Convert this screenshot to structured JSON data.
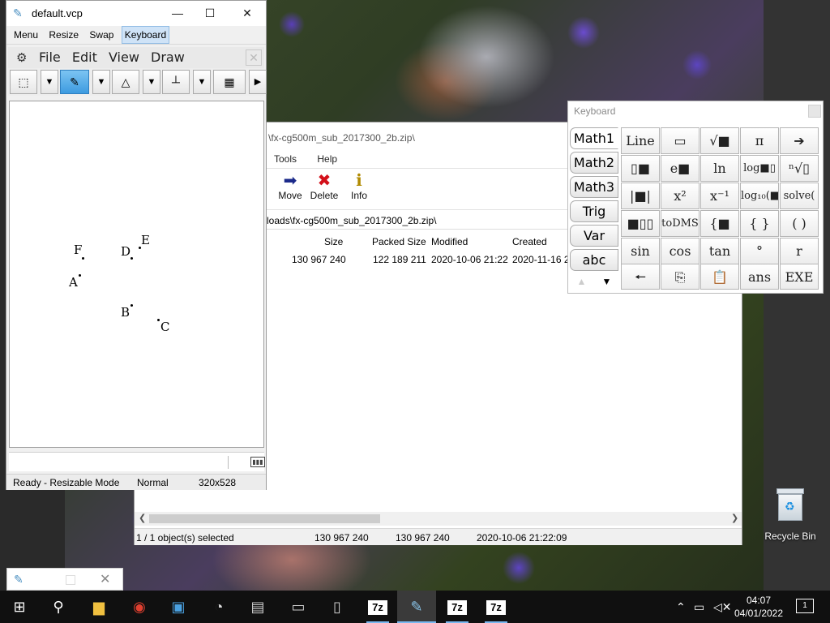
{
  "vcp": {
    "title": "default.vcp",
    "window_controls": {
      "minimize": "—",
      "maximize": "☐",
      "close": "✕"
    },
    "menubar": [
      "Menu",
      "Resize",
      "Swap",
      "Keyboard"
    ],
    "inner_menus": [
      "File",
      "Edit",
      "View",
      "Draw"
    ],
    "inner_close": "✕",
    "points": [
      {
        "label": "F"
      },
      {
        "label": "D"
      },
      {
        "label": "E"
      },
      {
        "label": "A"
      },
      {
        "label": "B"
      },
      {
        "label": "C"
      }
    ],
    "status": {
      "mode": "Ready - Resizable Mode",
      "state": "Normal",
      "size": "320x528"
    }
  },
  "keyboard": {
    "title": "Keyboard",
    "tabs": [
      "Math1",
      "Math2",
      "Math3",
      "Trig",
      "Var",
      "abc"
    ],
    "keys": [
      "Line",
      "▭",
      "√■",
      "π",
      "➔",
      "▯■",
      "e■",
      "ln",
      "log■▯",
      "ⁿ√▯",
      "|■|",
      "x²",
      "x⁻¹",
      "log₁₀(■)",
      "solve(",
      "■▯▯",
      "toDMS",
      "{■",
      "{ }",
      "( )",
      "sin",
      "cos",
      "tan",
      "°",
      "r"
    ],
    "bottom_keys": [
      "🠔",
      "⎘",
      "📋",
      "ans",
      "EXE"
    ],
    "arrows": [
      "▲",
      "▼"
    ]
  },
  "zip": {
    "title_path": "\\fx-cg500m_sub_2017300_2b.zip\\",
    "menus": [
      "Tools",
      "Help"
    ],
    "toolbar": [
      {
        "label": "Move",
        "icon": "➡"
      },
      {
        "label": "Delete",
        "icon": "✖"
      },
      {
        "label": "Info",
        "icon": "ℹ"
      }
    ],
    "address": "loads\\fx-cg500m_sub_2017300_2b.zip\\",
    "columns": [
      "Size",
      "Packed Size",
      "Modified",
      "Created"
    ],
    "row": {
      "size": "130 967 240",
      "packed": "122 189 211",
      "modified": "2020-10-06 21:22",
      "created": "2020-11-16 2"
    },
    "status": {
      "selected": "1 / 1 object(s) selected",
      "size": "130 967 240",
      "packed": "130 967 240",
      "date": "2020-10-06 21:22:09"
    }
  },
  "desktop": {
    "recycle_bin": "Recycle Bin"
  },
  "taskbar": {
    "seven_zip_label": "7z",
    "clock_time": "04:07",
    "clock_date": "04/01/2022",
    "notification_count": "1"
  }
}
